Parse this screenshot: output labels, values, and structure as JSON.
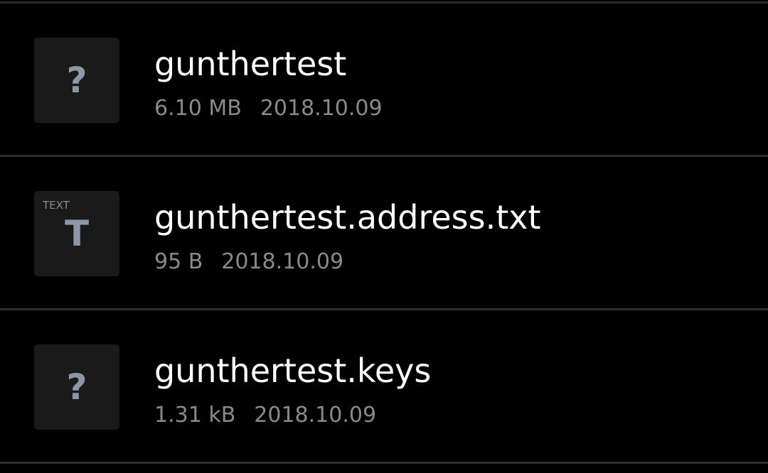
{
  "files": [
    {
      "icon": "unknown-file-icon",
      "icon_glyph": "?",
      "icon_label": "",
      "name": "gunthertest",
      "size": "6.10 MB",
      "date": "2018.10.09"
    },
    {
      "icon": "text-file-icon",
      "icon_glyph": "T",
      "icon_label": "TEXT",
      "name": "gunthertest.address.txt",
      "size": "95 B",
      "date": "2018.10.09"
    },
    {
      "icon": "unknown-file-icon",
      "icon_glyph": "?",
      "icon_label": "",
      "name": "gunthertest.keys",
      "size": "1.31 kB",
      "date": "2018.10.09"
    }
  ],
  "colors": {
    "background": "#000000",
    "divider": "#2b2b2b",
    "icon_background": "#1a1a1a",
    "icon_glyph": "#8c98a8",
    "name_text": "#ffffff",
    "meta_text": "#8a8a8a"
  }
}
